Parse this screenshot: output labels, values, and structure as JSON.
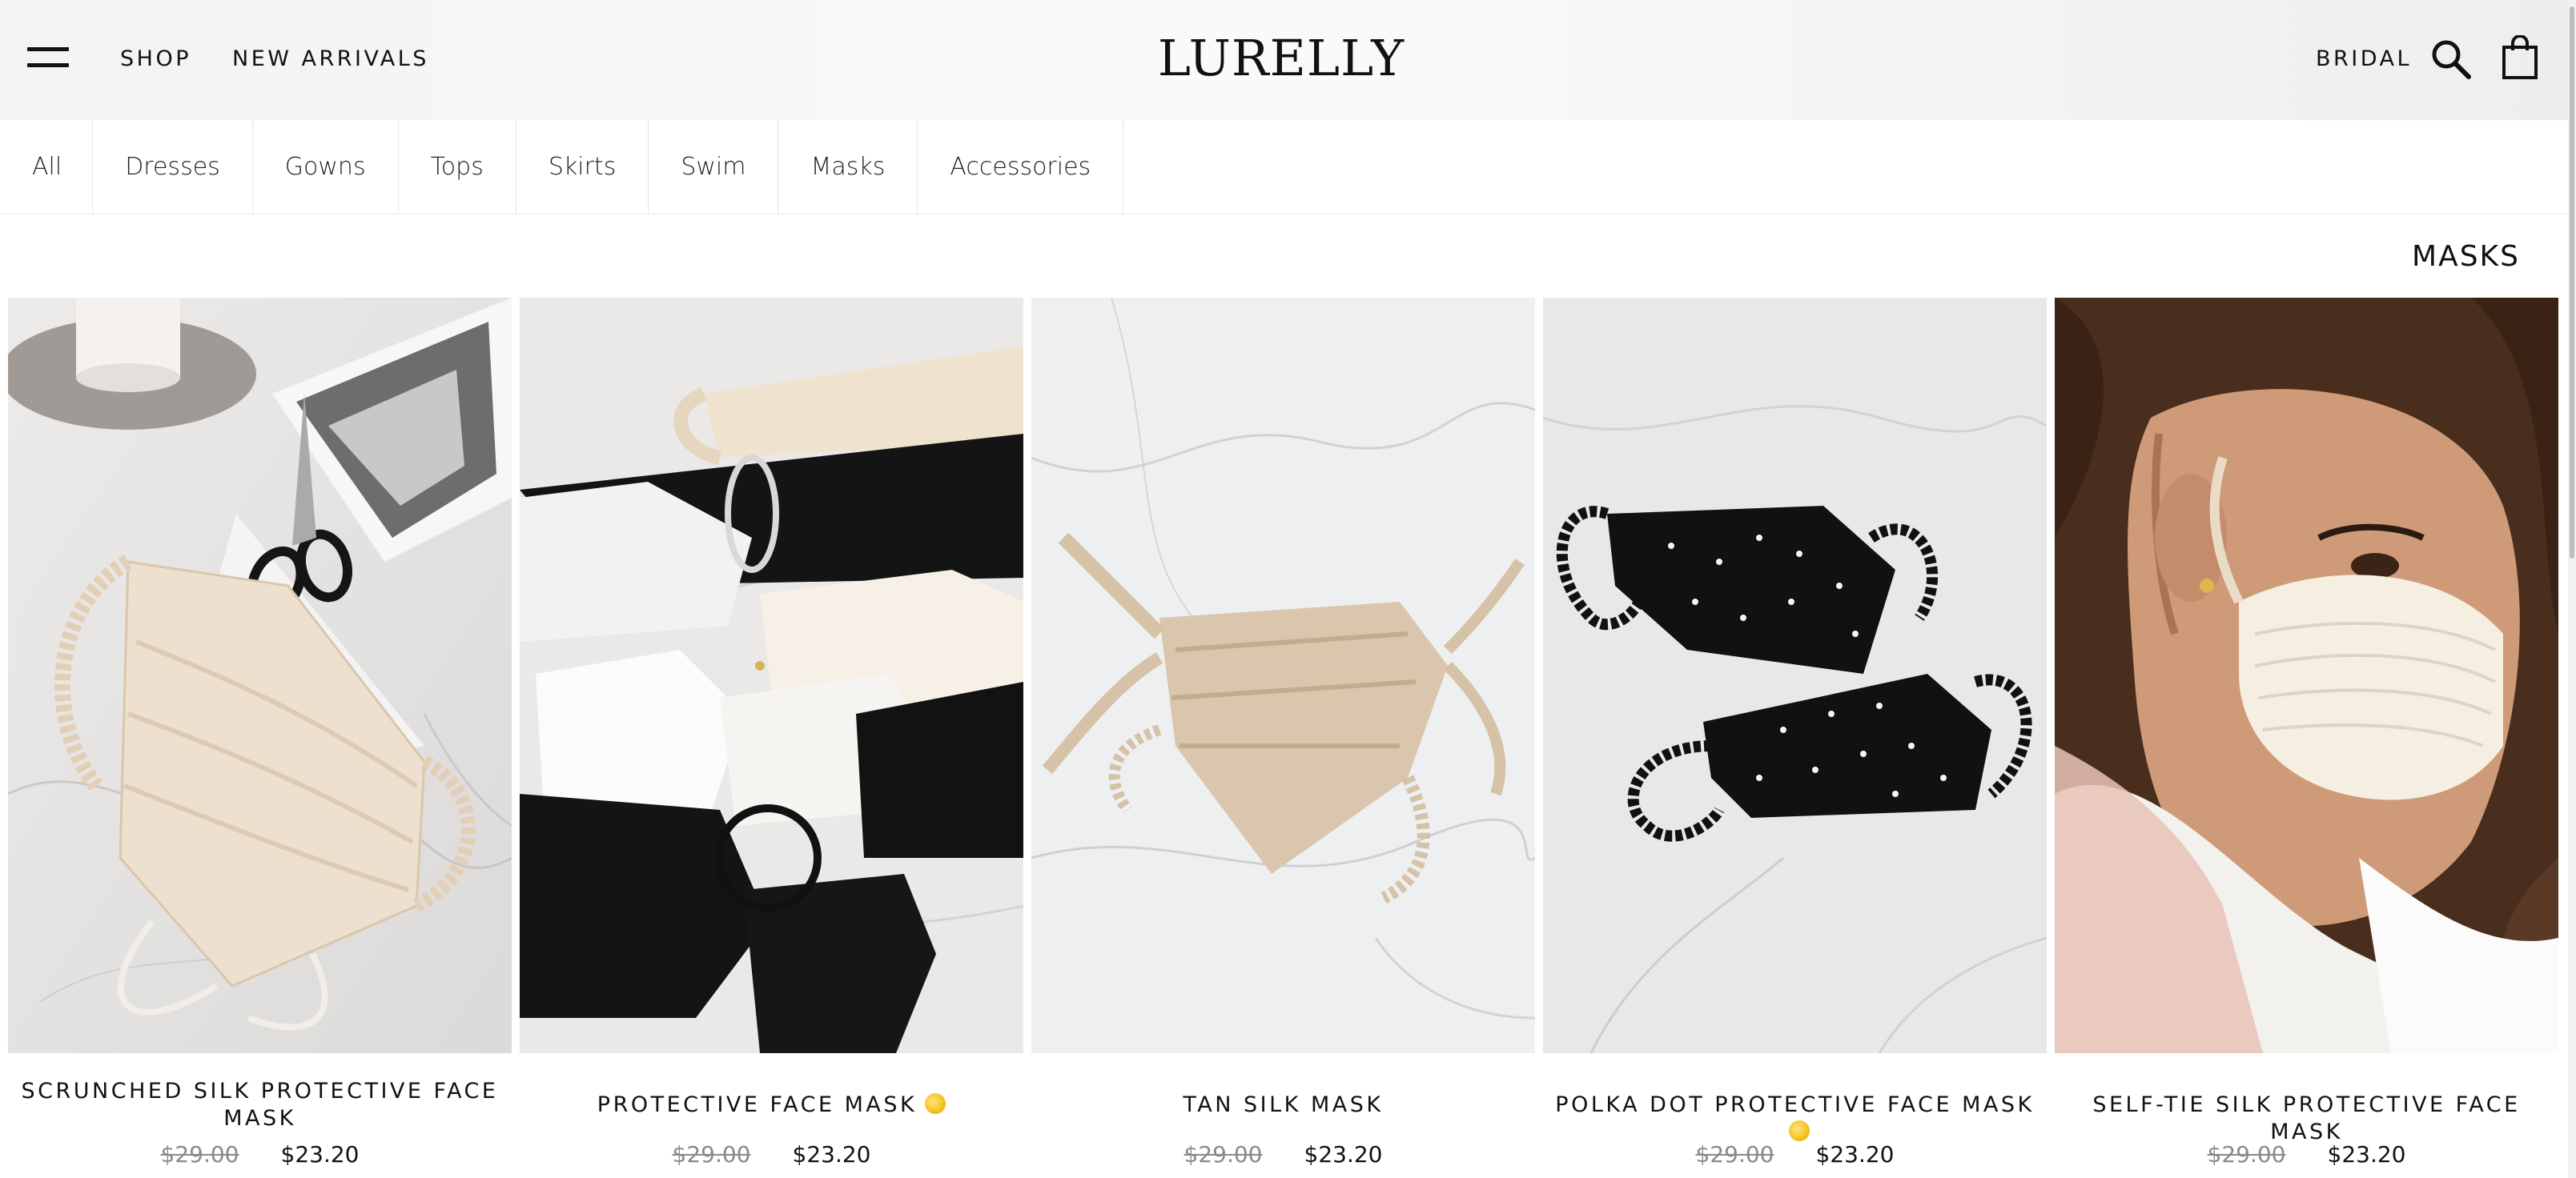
{
  "header": {
    "menu_icon": "hamburger-menu-icon",
    "nav_left": [
      "SHOP",
      "NEW ARRIVALS"
    ],
    "logo": "LURELLY",
    "nav_right": [
      "BRIDAL"
    ],
    "search_icon": "search-icon",
    "bag_icon": "shopping-bag-icon"
  },
  "tabs": [
    "All",
    "Dresses",
    "Gowns",
    "Tops",
    "Skirts",
    "Swim",
    "Masks",
    "Accessories"
  ],
  "collection": {
    "title": "MASKS"
  },
  "products": [
    {
      "name": "SCRUNCHED SILK PROTECTIVE FACE MASK",
      "old_price": "$29.00",
      "price": "$23.20",
      "emoji": ""
    },
    {
      "name": "PROTECTIVE FACE MASK",
      "old_price": "$29.00",
      "price": "$23.20",
      "emoji": "sun-emoji"
    },
    {
      "name": "TAN SILK MASK",
      "old_price": "$29.00",
      "price": "$23.20",
      "emoji": ""
    },
    {
      "name": "POLKA DOT PROTECTIVE FACE MASK",
      "old_price": "$29.00",
      "price": "$23.20",
      "emoji": "sun-emoji"
    },
    {
      "name": "SELF-TIE SILK PROTECTIVE FACE MASK",
      "old_price": "$29.00",
      "price": "$23.20",
      "emoji": ""
    }
  ],
  "colors": {
    "header_bg": "#f3f3f3",
    "text": "#111111",
    "old_price": "#8a8a8a",
    "marble": "#e9e7e6"
  }
}
